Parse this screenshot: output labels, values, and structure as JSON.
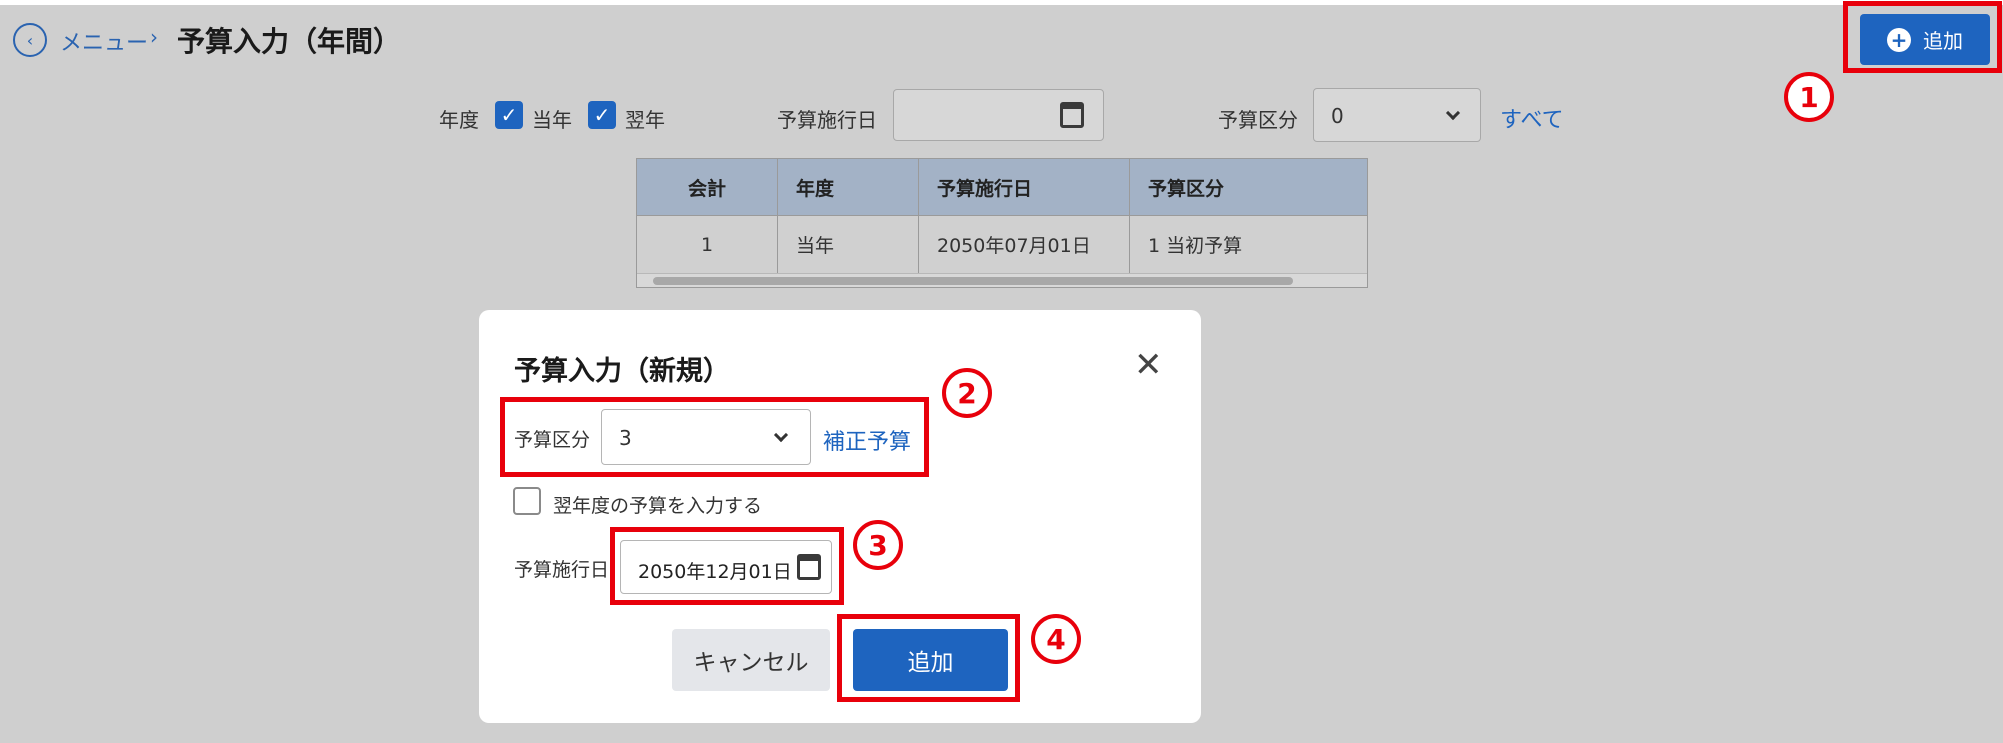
{
  "header": {
    "back_icon": "chevron-left-icon",
    "breadcrumb_menu": "メニュー",
    "breadcrumb_separator": "›",
    "title": "予算入力（年間）",
    "add_button_label": "追加"
  },
  "filters": {
    "fiscal_year_label": "年度",
    "current_year_label": "当年",
    "current_year_checked": true,
    "next_year_label": "翌年",
    "next_year_checked": true,
    "effective_date_label": "予算施行日",
    "effective_date_value": "",
    "category_label": "予算区分",
    "category_value": "0",
    "category_name": "すべて"
  },
  "table": {
    "columns": [
      "会計",
      "年度",
      "予算施行日",
      "予算区分"
    ],
    "rows": [
      [
        "1",
        "当年",
        "2050年07月01日",
        "1 当初予算"
      ]
    ]
  },
  "modal": {
    "title": "予算入力（新規）",
    "category_label": "予算区分",
    "category_value": "3",
    "category_name": "補正予算",
    "next_year_checkbox_label": "翌年度の予算を入力する",
    "next_year_checked": false,
    "effective_date_label": "予算施行日",
    "effective_date_value": "2050年12月01日",
    "cancel_label": "キャンセル",
    "add_label": "追加"
  },
  "callouts": [
    "1",
    "2",
    "3",
    "4"
  ],
  "colors": {
    "accent": "#1e64bf",
    "highlight": "#e8000b",
    "overlay": "#cfcfcf",
    "table_header": "#a3b2c6"
  }
}
